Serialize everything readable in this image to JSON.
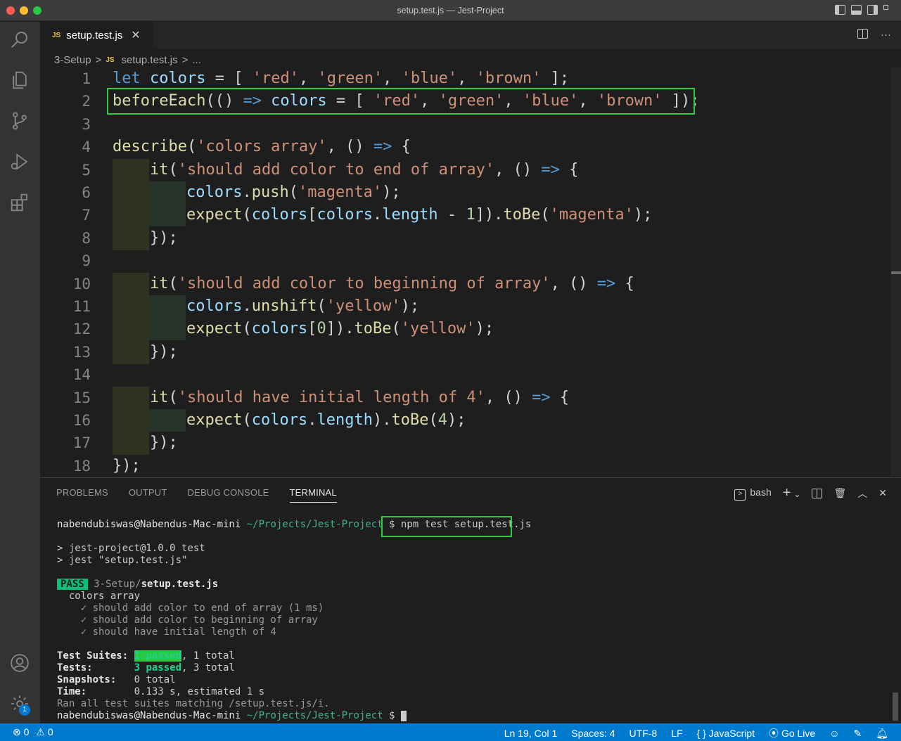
{
  "window": {
    "title": "setup.test.js — Jest-Project"
  },
  "tab": {
    "icon": "JS",
    "label": "setup.test.js",
    "close": "✕"
  },
  "editor_actions": {
    "more": "···"
  },
  "breadcrumb": {
    "folder": "3-Setup",
    "sep1": ">",
    "file": "setup.test.js",
    "sep2": ">",
    "more": "..."
  },
  "code_lines": [
    {
      "n": "1"
    },
    {
      "n": "2"
    },
    {
      "n": "3"
    },
    {
      "n": "4"
    },
    {
      "n": "5"
    },
    {
      "n": "6"
    },
    {
      "n": "7"
    },
    {
      "n": "8"
    },
    {
      "n": "9"
    },
    {
      "n": "10"
    },
    {
      "n": "11"
    },
    {
      "n": "12"
    },
    {
      "n": "13"
    },
    {
      "n": "14"
    },
    {
      "n": "15"
    },
    {
      "n": "16"
    },
    {
      "n": "17"
    },
    {
      "n": "18"
    }
  ],
  "code": {
    "l1": {
      "kw": "let",
      "var": "colors",
      "op": " = [ ",
      "s1": "'red'",
      "c1": ", ",
      "s2": "'green'",
      "c2": ", ",
      "s3": "'blue'",
      "c3": ", ",
      "s4": "'brown'",
      "end": " ];"
    },
    "l2": {
      "fn": "beforeEach",
      "p1": "(() ",
      "arrow": "=>",
      "var": " colors",
      "op": " = [ ",
      "s1": "'red'",
      "c1": ", ",
      "s2": "'green'",
      "c2": ", ",
      "s3": "'blue'",
      "c3": ", ",
      "s4": "'brown'",
      "end": " ]);"
    },
    "l4": {
      "fn": "describe",
      "p1": "(",
      "s": "'colors array'",
      "p2": ", () ",
      "arrow": "=>",
      "end": " {"
    },
    "l5": {
      "fn": "it",
      "p1": "(",
      "s": "'should add color to end of array'",
      "p2": ", () ",
      "arrow": "=>",
      "end": " {"
    },
    "l6": {
      "var": "colors",
      "dot": ".",
      "fn": "push",
      "p1": "(",
      "s": "'magenta'",
      "end": ");"
    },
    "l7": {
      "fn": "expect",
      "p1": "(",
      "v1": "colors",
      "b1": "[",
      "v2": "colors",
      "dot": ".",
      "prop": "length",
      "op": " - ",
      "num": "1",
      "p2": "]).",
      "fn2": "toBe",
      "p3": "(",
      "s": "'magenta'",
      "end": ");"
    },
    "l8": {
      "end": "});"
    },
    "l10": {
      "fn": "it",
      "p1": "(",
      "s": "'should add color to beginning of array'",
      "p2": ", () ",
      "arrow": "=>",
      "end": " {"
    },
    "l11": {
      "var": "colors",
      "dot": ".",
      "fn": "unshift",
      "p1": "(",
      "s": "'yellow'",
      "end": ");"
    },
    "l12": {
      "fn": "expect",
      "p1": "(",
      "v1": "colors",
      "b1": "[",
      "num": "0",
      "p2": "]).",
      "fn2": "toBe",
      "p3": "(",
      "s": "'yellow'",
      "end": ");"
    },
    "l13": {
      "end": "});"
    },
    "l15": {
      "fn": "it",
      "p1": "(",
      "s": "'should have initial length of 4'",
      "p2": ", () ",
      "arrow": "=>",
      "end": " {"
    },
    "l16": {
      "fn": "expect",
      "p1": "(",
      "v1": "colors",
      "dot": ".",
      "prop": "length",
      "p2": ").",
      "fn2": "toBe",
      "p3": "(",
      "num": "4",
      "end": ");"
    },
    "l17": {
      "end": "});"
    },
    "l18": {
      "end": "});"
    }
  },
  "panel": {
    "tabs": [
      "PROBLEMS",
      "OUTPUT",
      "DEBUG CONSOLE",
      "TERMINAL"
    ],
    "shell": "bash",
    "add": "+",
    "chevron": "⌄",
    "trash": "🗑",
    "up": "︿",
    "close": "✕"
  },
  "terminal": {
    "user": "nabendubiswas@Nabendus-Mac-mini",
    "path": "~/Projects/Jest-Project",
    "prompt": "$",
    "command": "npm test setup.test.js",
    "out1": "> jest-project@1.0.0 test",
    "out2": "> jest \"setup.test.js\"",
    "pass": "PASS",
    "pass_dir": "3-Setup/",
    "pass_file": "setup.test.js",
    "suite": "  colors array",
    "t1": "    ✓ should add color to end of array (1 ms)",
    "t2": "    ✓ should add color to beginning of array",
    "t3": "    ✓ should have initial length of 4",
    "suites_label": "Test Suites:",
    "suites_passed": "1 passed",
    "suites_total": ", 1 total",
    "tests_label": "Tests:",
    "tests_passed": "3 passed",
    "tests_total": ", 3 total",
    "snap_label": "Snapshots:",
    "snap_val": "0 total",
    "time_label": "Time:",
    "time_val": "0.133 s, estimated 1 s",
    "ran": "Ran all test suites matching /setup.test.js/i."
  },
  "status": {
    "errors": "⊗ 0",
    "warnings": "⚠ 0",
    "position": "Ln 19, Col 1",
    "spaces": "Spaces: 4",
    "encoding": "UTF-8",
    "eol": "LF",
    "language": "{ } JavaScript",
    "golive": "Go Live",
    "settings_badge": "1"
  }
}
